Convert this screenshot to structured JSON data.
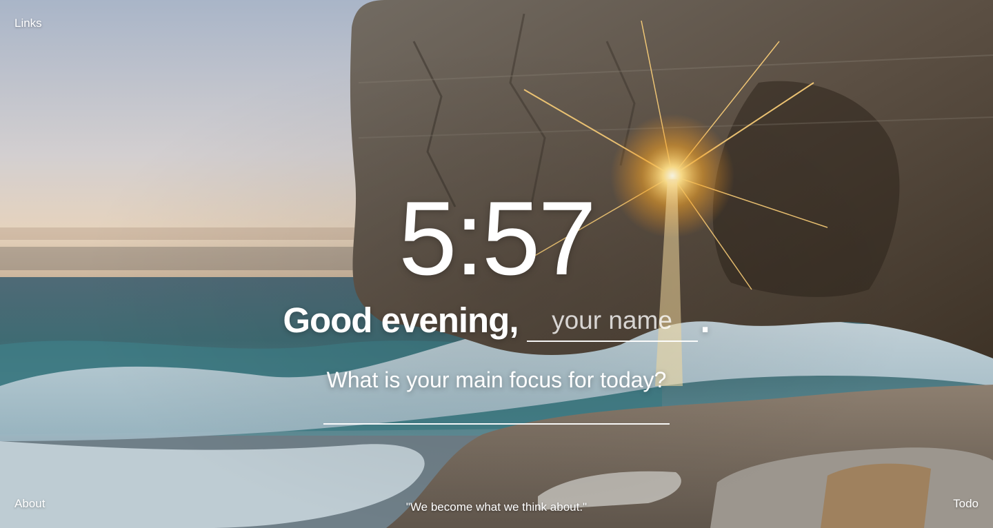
{
  "top_left": {
    "links_label": "Links"
  },
  "clock": {
    "time": "5:57"
  },
  "greeting": {
    "text": "Good evening,",
    "name_placeholder": "your name",
    "trailing": "."
  },
  "focus": {
    "question": "What is your main focus for today?",
    "value": ""
  },
  "footer": {
    "about_label": "About",
    "quote": "\"We become what we think about.\"",
    "todo_label": "Todo"
  }
}
